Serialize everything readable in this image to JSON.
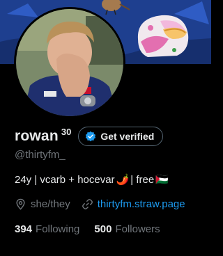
{
  "profile": {
    "display_name": "rowan",
    "name_superscript": "30",
    "verify_label": "Get verified",
    "handle": "@thirtyfm_",
    "bio": {
      "text_before": "24y | vcarb + hocevar",
      "pepper_emoji": "🌶️",
      "text_after": "| free",
      "flag_emoji": "🇵🇸"
    },
    "pronouns": "she/they",
    "website": "thirtyfm.straw.page",
    "following_count": "394",
    "following_label": "Following",
    "followers_count": "500",
    "followers_label": "Followers"
  },
  "colors": {
    "background": "#000000",
    "banner": "#1e3f8f",
    "verified_blue": "#1d9bf0",
    "muted_text": "#71767b"
  }
}
